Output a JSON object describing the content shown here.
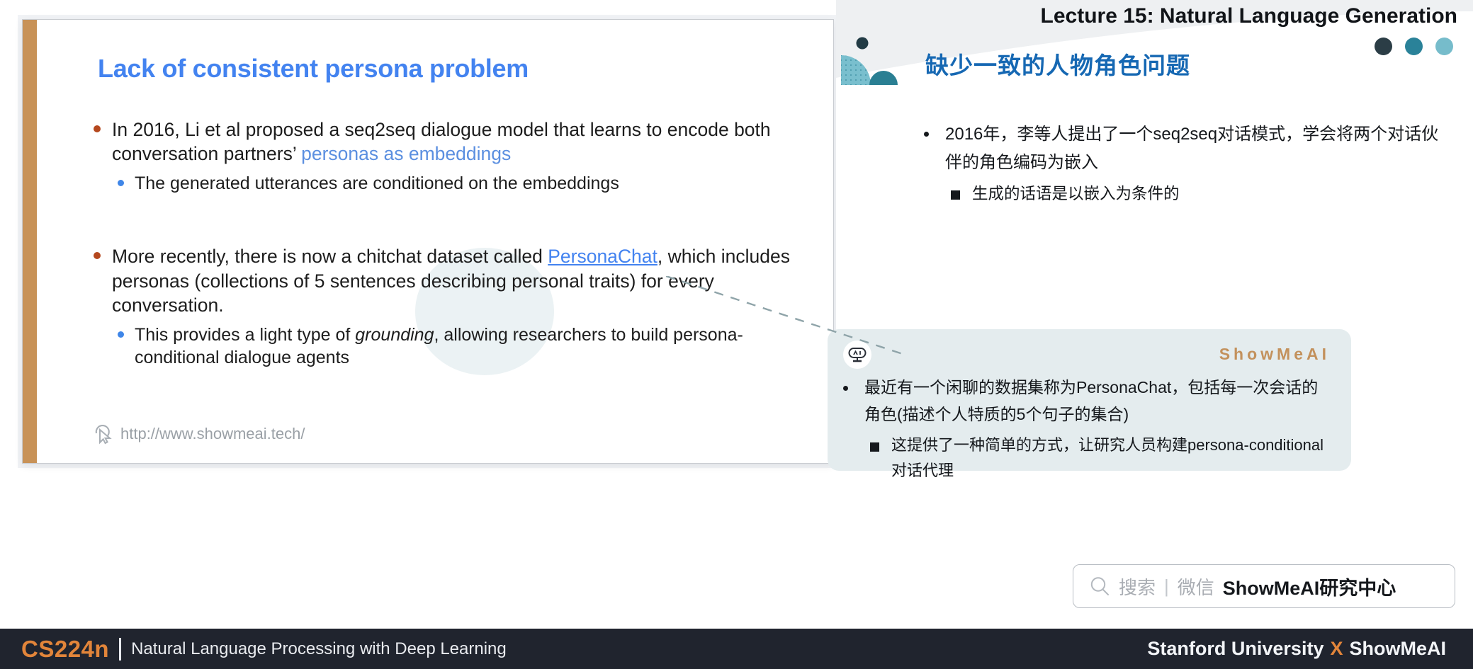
{
  "slide": {
    "title": "Lack of consistent persona problem",
    "bullets": [
      {
        "level": 1,
        "segments": [
          {
            "text": "In 2016, Li et al proposed a seq2seq dialogue model that learns to encode both conversation partners’ ",
            "style": "plain"
          },
          {
            "text": "personas as embeddings",
            "style": "blue"
          }
        ]
      },
      {
        "level": 2,
        "segments": [
          {
            "text": "The generated utterances are conditioned on the embeddings",
            "style": "plain"
          }
        ]
      },
      {
        "level": 1,
        "segments": [
          {
            "text": "More recently, there is now a chitchat dataset called ",
            "style": "plain"
          },
          {
            "text": "PersonaChat",
            "style": "link"
          },
          {
            "text": ", which includes personas (collections of 5 sentences describing personal traits) for every conversation.",
            "style": "plain"
          }
        ]
      },
      {
        "level": 2,
        "segments": [
          {
            "text": "This provides a light type of ",
            "style": "plain"
          },
          {
            "text": "grounding",
            "style": "italic"
          },
          {
            "text": ", allowing researchers to build persona-conditional dialogue agents",
            "style": "plain"
          }
        ]
      }
    ],
    "watermark_url": "http://www.showmeai.tech/",
    "cursor_icon": "cursor-arrow-icon",
    "accent_bar_color": "#c89257",
    "title_color": "#4383f0",
    "bullet1_color": "#b5481e",
    "bullet2_color": "#3f86e8"
  },
  "header": {
    "lecture_title": "Lecture 15: Natural Language Generation",
    "cn_title": "缺少一致的人物角色问题",
    "cn_title_color": "#1668b3",
    "dots": [
      {
        "name": "dot-dark",
        "color": "#2b3d46"
      },
      {
        "name": "dot-teal",
        "color": "#2a8299"
      },
      {
        "name": "dot-light",
        "color": "#76bccb"
      }
    ],
    "decoration_icon": "quarter-circle-deco-icon"
  },
  "translation": {
    "bullets": [
      {
        "level": 1,
        "text": "2016年，李等人提出了一个seq2seq对话模式，学会将两个对话伙伴的角色编码为嵌入"
      },
      {
        "level": 2,
        "text": "生成的话语是以嵌入为条件的"
      }
    ]
  },
  "translation_card": {
    "bot_icon": "robot-face-icon",
    "brand": "ShowMeAI",
    "brand_color": "#c3915c",
    "background": "#e4ecee",
    "bullets": [
      {
        "level": 1,
        "text": "最近有一个闲聊的数据集称为PersonaChat，包括每一次会话的角色(描述个人特质的5个句子的集合)"
      },
      {
        "level": 2,
        "text": "这提供了一种简单的方式，让研究人员构建persona-conditional 对话代理"
      }
    ]
  },
  "search_pill": {
    "icon": "search-icon",
    "placeholder": "搜索",
    "separator": "|",
    "channel": "微信",
    "account": "ShowMeAI研究中心"
  },
  "footer": {
    "course_code": "CS224n",
    "course_name": "Natural Language Processing with Deep Learning",
    "org_left": "Stanford University",
    "org_x": "X",
    "org_right": "ShowMeAI",
    "background": "#20242e",
    "accent": "#e2853a"
  }
}
